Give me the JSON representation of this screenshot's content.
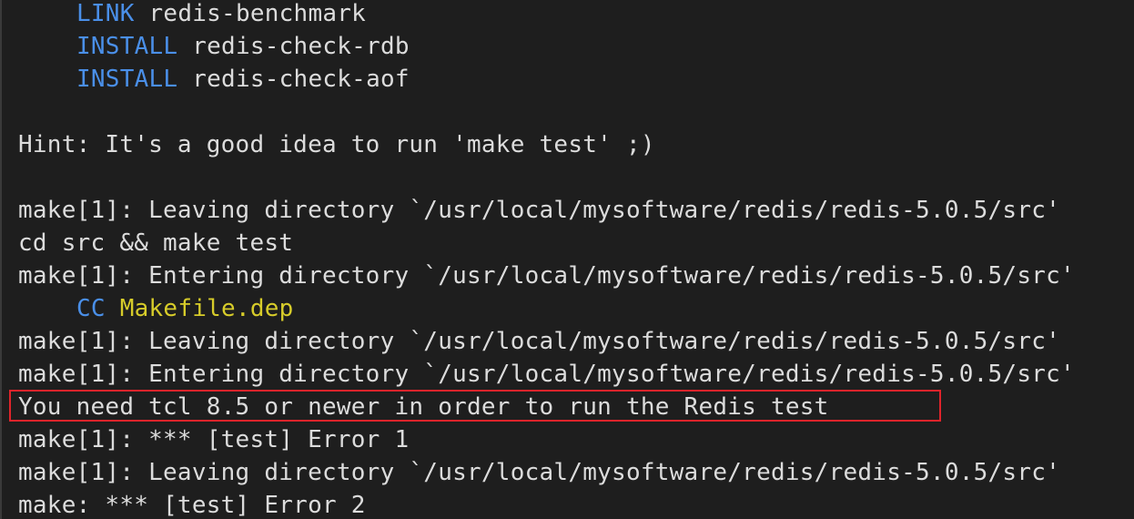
{
  "terminal": {
    "lines": [
      {
        "kw": "LINK",
        "text": " redis-benchmark"
      },
      {
        "kw": "INSTALL",
        "text": " redis-check-rdb"
      },
      {
        "kw": "INSTALL",
        "text": " redis-check-aof"
      },
      {
        "text": "Hint: It's a good idea to run 'make test' ;)"
      },
      {
        "text": "make[1]: Leaving directory `/usr/local/mysoftware/redis/redis-5.0.5/src'"
      },
      {
        "text": "cd src && make test"
      },
      {
        "text": "make[1]: Entering directory `/usr/local/mysoftware/redis/redis-5.0.5/src'"
      },
      {
        "kw": "CC",
        "text": " ",
        "target": "Makefile.dep"
      },
      {
        "text": "make[1]: Leaving directory `/usr/local/mysoftware/redis/redis-5.0.5/src'"
      },
      {
        "text": "make[1]: Entering directory `/usr/local/mysoftware/redis/redis-5.0.5/src'"
      },
      {
        "text": "You need tcl 8.5 or newer in order to run the Redis test"
      },
      {
        "text": "make[1]: *** [test] Error 1"
      },
      {
        "text": "make[1]: Leaving directory `/usr/local/mysoftware/redis/redis-5.0.5/src'"
      },
      {
        "text": "make: *** [test] Error 2"
      }
    ]
  },
  "colors": {
    "background": "#1e1e1e",
    "text": "#dcdcdc",
    "keyword": "#4a8fe8",
    "target": "#d7cc2a",
    "highlight": "#e0242b"
  }
}
